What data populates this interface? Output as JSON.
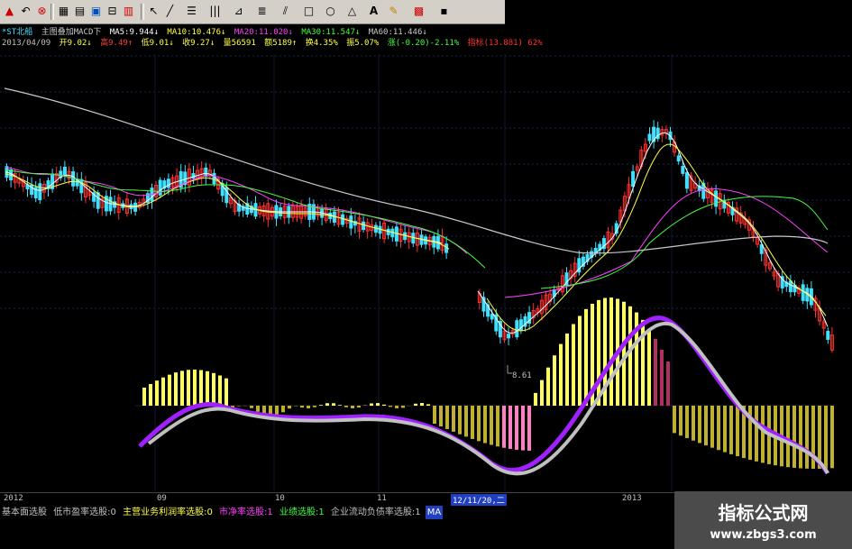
{
  "colors": {
    "up": "#ff3030",
    "down": "#40e0ff",
    "ma5": "#ffffff",
    "ma10": "#ffff40",
    "ma20": "#ff40ff",
    "ma30": "#40ff40",
    "ma60": "#c8c8c8",
    "dif": "#a020ff",
    "dea": "#c0c0c0",
    "hist_pos": "#ffff60",
    "hist_neg": "#c0b030"
  },
  "info1": {
    "name": "*ST北船",
    "indicator": "主图叠加MACD下",
    "ma5": "MA5:9.944↓",
    "ma10": "MA10:10.476↓",
    "ma20": "MA20:11.020↓",
    "ma30": "MA30:11.547↓",
    "ma60": "MA60:11.446↓"
  },
  "info2": {
    "date": "2013/04/09",
    "open": "开9.02↓",
    "high": "高9.49↑",
    "low": "低9.01↓",
    "close": "收9.27↓",
    "volume": "量56591",
    "amount": "额5189↑",
    "turnover": "换4.35%",
    "amplitude": "振5.07%",
    "change": "涨(-0.20)-2.11%",
    "extra": "指标(13.881) 62%"
  },
  "chart_data": {
    "type": "line",
    "low_annotation": "8.61",
    "x_labels": [
      "2012",
      "09",
      "10",
      "11",
      "12/11/20,二",
      "2013"
    ]
  },
  "axis": {
    "labels": [
      "2012",
      "09",
      "10",
      "11",
      "12/11/20,二",
      "2013"
    ]
  },
  "bottom": {
    "items": [
      "基本面选股",
      "低市盈率选股:0",
      "主营业务利润率选股:0",
      "市净率选股:1",
      "业绩选股:1",
      "企业流动负债率选股:1",
      "MA"
    ]
  },
  "watermark": {
    "title": "指标公式网",
    "url": "www.zbgs3.com"
  },
  "icons": [
    "fullscreen-icon",
    "back-icon",
    "lock-icon",
    "pin-icon",
    "grid-icon",
    "list-icon",
    "window-icon",
    "arrow-icon",
    "cursor-icon",
    "line-icon",
    "period-icon",
    "vline-icon",
    "fan-icon",
    "channel-icon",
    "rect-icon",
    "ellipse-icon",
    "triangle-icon",
    "text-icon",
    "eraser-icon",
    "color-icon",
    "save-icon"
  ]
}
